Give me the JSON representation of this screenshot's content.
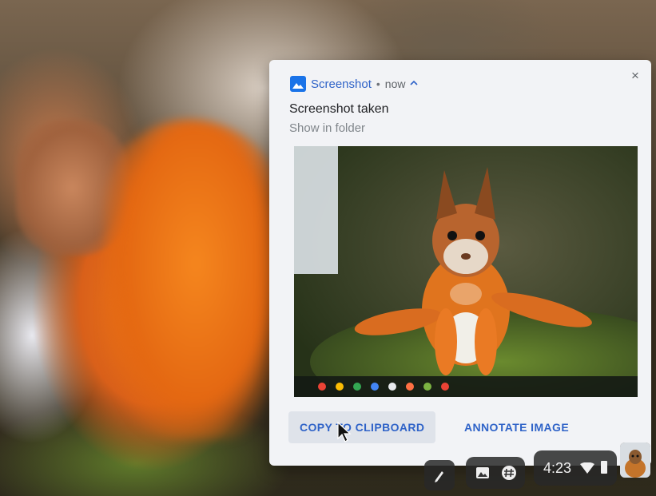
{
  "notification": {
    "app_name": "Screenshot",
    "separator": "•",
    "time": "now",
    "expand_chevron": "^",
    "close_glyph": "×",
    "title": "Screenshot taken",
    "subtitle": "Show in folder",
    "preview_icon": "squirrel-screenshot-thumbnail",
    "actions": {
      "copy_label": "COPY TO CLIPBOARD",
      "annotate_label": "ANNOTATE IMAGE"
    }
  },
  "shelf": {
    "clock": "4:23",
    "icons": [
      "stylus-icon",
      "photos-icon",
      "hashtag-icon",
      "wifi-icon",
      "battery-icon",
      "avatar"
    ]
  },
  "colors": {
    "accent": "#2f63c8",
    "card": "#f2f3f6",
    "tray": "#282828"
  }
}
